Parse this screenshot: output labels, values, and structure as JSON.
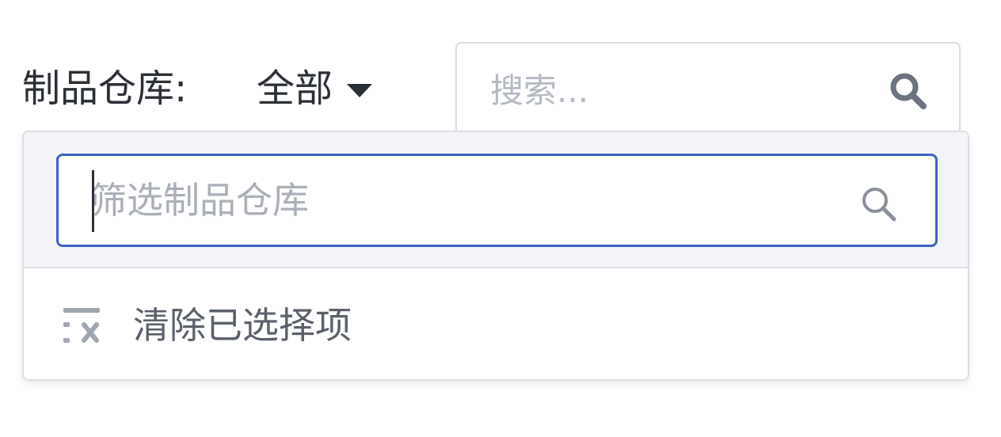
{
  "filter": {
    "label": "制品仓库:",
    "value": "全部"
  },
  "search": {
    "placeholder": "搜索..."
  },
  "dropdown": {
    "filter_placeholder": "筛选制品仓库",
    "clear_label": "清除已选择项"
  },
  "icons": {
    "caret": "caret-down-icon",
    "search": "search-icon",
    "filter_search": "search-icon",
    "clear": "clear-selection-icon"
  },
  "colors": {
    "text": "#2b2f36",
    "placeholder": "#b3b8c2",
    "focus_border": "#3b63c4",
    "dropdown_header_bg": "#f4f5f9",
    "muted_text": "#5a606b"
  }
}
